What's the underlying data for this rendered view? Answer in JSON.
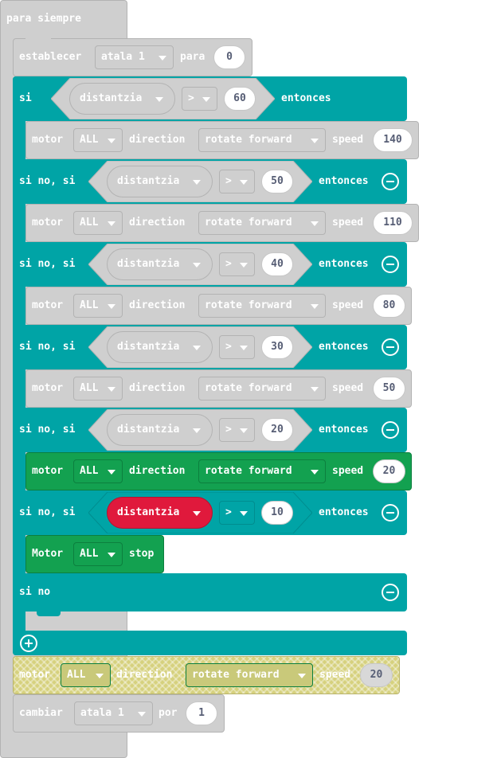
{
  "forever": {
    "label": "para siempre"
  },
  "set_block": {
    "label": "establecer",
    "variable": "atala 1",
    "to_label": "para",
    "value": "0"
  },
  "if_block": {
    "if_label": "si",
    "then_label": "entonces",
    "else_if_label": "si no, si",
    "else_label": "si no",
    "branches": [
      {
        "sensor": "distantzia",
        "operator": ">",
        "value": "60"
      },
      {
        "sensor": "distantzia",
        "operator": ">",
        "value": "50"
      },
      {
        "sensor": "distantzia",
        "operator": ">",
        "value": "40"
      },
      {
        "sensor": "distantzia",
        "operator": ">",
        "value": "30"
      },
      {
        "sensor": "distantzia",
        "operator": ">",
        "value": "20"
      },
      {
        "sensor": "distantzia",
        "operator": ">",
        "value": "10"
      }
    ]
  },
  "motor_blocks": [
    {
      "label": "motor",
      "motor": "ALL",
      "direction_label": "direction",
      "direction": "rotate forward",
      "speed_label": "speed",
      "speed": "140"
    },
    {
      "label": "motor",
      "motor": "ALL",
      "direction_label": "direction",
      "direction": "rotate forward",
      "speed_label": "speed",
      "speed": "110"
    },
    {
      "label": "motor",
      "motor": "ALL",
      "direction_label": "direction",
      "direction": "rotate forward",
      "speed_label": "speed",
      "speed": "80"
    },
    {
      "label": "motor",
      "motor": "ALL",
      "direction_label": "direction",
      "direction": "rotate forward",
      "speed_label": "speed",
      "speed": "50"
    },
    {
      "label": "motor",
      "motor": "ALL",
      "direction_label": "direction",
      "direction": "rotate forward",
      "speed_label": "speed",
      "speed": "20"
    }
  ],
  "stop_block": {
    "label": "Motor",
    "motor": "ALL",
    "action": "stop"
  },
  "loose_motor": {
    "label": "motor",
    "motor": "ALL",
    "direction_label": "direction",
    "direction": "rotate forward",
    "speed_label": "speed",
    "speed": "20"
  },
  "change_block": {
    "label": "cambiar",
    "variable": "atala 1",
    "by_label": "por",
    "value": "1"
  },
  "colors": {
    "gray": "#cfcfcf",
    "teal": "#00a4a6",
    "green": "#13a150",
    "red": "#e0193c",
    "hatched": "#d6d17e"
  }
}
